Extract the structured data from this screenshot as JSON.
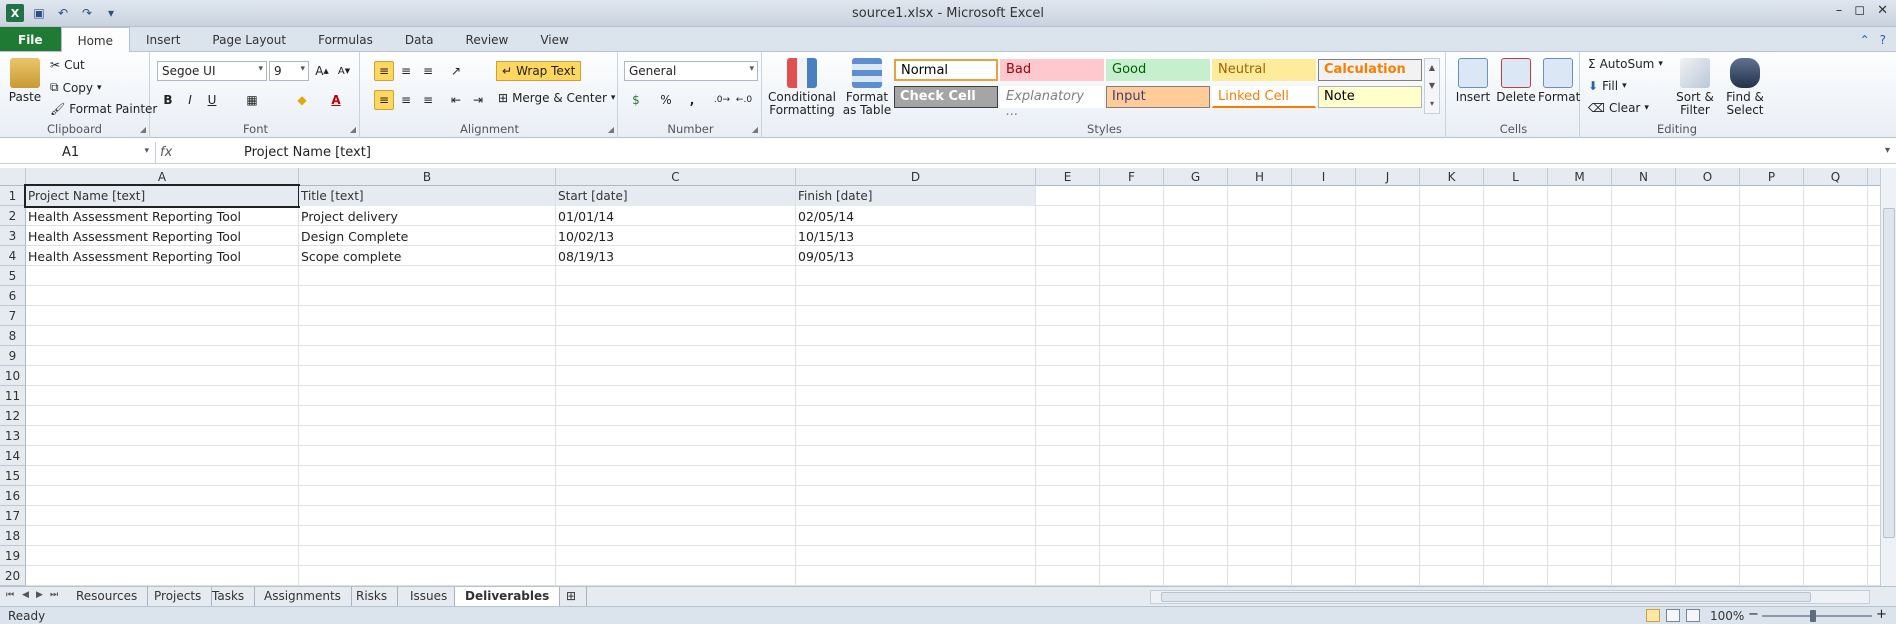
{
  "window": {
    "title": "source1.xlsx - Microsoft Excel",
    "controls": [
      "–",
      "◻",
      "✕"
    ]
  },
  "qat_icons": [
    "excel-logo",
    "save-icon",
    "undo-icon",
    "redo-icon",
    "customize-icon"
  ],
  "ribbon_tabs": [
    "File",
    "Home",
    "Insert",
    "Page Layout",
    "Formulas",
    "Data",
    "Review",
    "View"
  ],
  "active_tab": "Home",
  "clipboard": {
    "label": "Clipboard",
    "paste": "Paste",
    "cut": "Cut",
    "copy": "Copy",
    "format_painter": "Format Painter"
  },
  "font": {
    "label": "Font",
    "name": "Segoe UI",
    "size": "9",
    "bold": "B",
    "italic": "I",
    "underline": "U"
  },
  "alignment": {
    "label": "Alignment",
    "wrap_text": "Wrap Text",
    "merge_center": "Merge & Center"
  },
  "number": {
    "label": "Number",
    "format": "General",
    "percent": "%",
    "comma": ","
  },
  "styles": {
    "label": "Styles",
    "conditional": "Conditional",
    "conditional2": "Formatting",
    "format_as": "Format",
    "format_as2": "as Table",
    "cells": [
      {
        "name": "Normal",
        "bg": "#ffffff",
        "fg": "#000000",
        "border": "#e8a13b"
      },
      {
        "name": "Bad",
        "bg": "#ffc7ce",
        "fg": "#9c0006",
        "border": "#ffc7ce"
      },
      {
        "name": "Good",
        "bg": "#c6efce",
        "fg": "#006100",
        "border": "#c6efce"
      },
      {
        "name": "Neutral",
        "bg": "#ffeb9c",
        "fg": "#9c6500",
        "border": "#ffeb9c"
      },
      {
        "name": "Calculation",
        "bg": "#f2f2f2",
        "fg": "#fa7d00",
        "border": "#7f7f7f"
      },
      {
        "name": "Check Cell",
        "bg": "#a5a5a5",
        "fg": "#ffffff",
        "border": "#3f3f3f"
      },
      {
        "name": "Explanatory ...",
        "bg": "#ffffff",
        "fg": "#7f7f7f",
        "border": "#ffffff"
      },
      {
        "name": "Input",
        "bg": "#ffcc99",
        "fg": "#3f3f76",
        "border": "#7f7f7f"
      },
      {
        "name": "Linked Cell",
        "bg": "#ffffff",
        "fg": "#fa7d00",
        "border": "#ffffff"
      },
      {
        "name": "Note",
        "bg": "#ffffcc",
        "fg": "#000000",
        "border": "#b2b2b2"
      }
    ]
  },
  "cells_group": {
    "label": "Cells",
    "insert": "Insert",
    "delete": "Delete",
    "format": "Format"
  },
  "editing": {
    "label": "Editing",
    "autosum": "AutoSum",
    "fill": "Fill",
    "clear": "Clear",
    "sort": "Sort &",
    "sort2": "Filter",
    "find": "Find &",
    "find2": "Select"
  },
  "formula_bar": {
    "name_box": "A1",
    "fx": "fx",
    "content": "Project Name [text]"
  },
  "sheet": {
    "columns": [
      "A",
      "B",
      "C",
      "D",
      "E",
      "F",
      "G",
      "H",
      "I",
      "J",
      "K",
      "L",
      "M",
      "N",
      "O",
      "P",
      "Q"
    ],
    "row_numbers": [
      "1",
      "2",
      "3",
      "4",
      "5",
      "6",
      "7",
      "8",
      "9",
      "10",
      "11",
      "12",
      "13",
      "14",
      "15",
      "16",
      "17",
      "18",
      "19",
      "20"
    ],
    "header_row": [
      "Project Name [text]",
      "Title [text]",
      "Start [date]",
      "Finish [date]"
    ],
    "rows": [
      [
        "Health Assessment Reporting Tool",
        "Project delivery",
        "01/01/14",
        "02/05/14"
      ],
      [
        "Health Assessment Reporting Tool",
        "Design Complete",
        "10/02/13",
        "10/15/13"
      ],
      [
        "Health Assessment Reporting Tool",
        "Scope complete",
        "08/19/13",
        "09/05/13"
      ]
    ]
  },
  "sheet_tabs": [
    "Resources",
    "Projects",
    "Tasks",
    "Assignments",
    "Risks",
    "Issues",
    "Deliverables"
  ],
  "active_sheet": "Deliverables",
  "status": {
    "text": "Ready",
    "zoom": "100%"
  }
}
